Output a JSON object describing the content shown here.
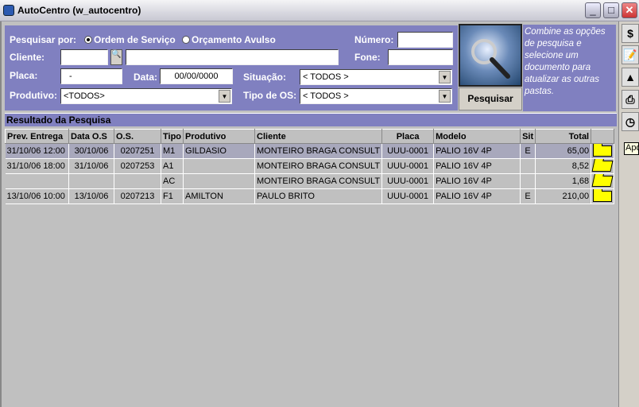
{
  "window": {
    "title": "AutoCentro (w_autocentro)",
    "minimize": "_",
    "maximize": "□",
    "close": "✕"
  },
  "search": {
    "search_by_label": "Pesquisar por:",
    "options": [
      {
        "label": "Ordem de Serviço",
        "selected": true
      },
      {
        "label": "Orçamento Avulso",
        "selected": false
      }
    ],
    "numero_label": "Número:",
    "numero_value": "",
    "cliente_label": "Cliente:",
    "cliente_code": "",
    "cliente_name": "",
    "fone_label": "Fone:",
    "fone_value": "",
    "placa_label": "Placa:",
    "placa_value": "-",
    "data_label": "Data:",
    "data_value": "00/00/0000",
    "situacao_label": "Situação:",
    "situacao_value": "< TODOS >",
    "produtivo_label": "Produtivo:",
    "produtivo_value": "<TODOS>",
    "tipo_os_label": "Tipo de OS:",
    "tipo_os_value": "< TODOS >",
    "button": "Pesquisar",
    "help": "Combine as opções de pesquisa e selecione um documento para atualizar as outras pastas."
  },
  "result": {
    "title": "Resultado da Pesquisa",
    "columns": [
      "Prev. Entrega",
      "Data O.S",
      "O.S.",
      "Tipo",
      "Produtivo",
      "Cliente",
      "Placa",
      "Modelo",
      "Sit",
      "Total",
      ""
    ],
    "rows": [
      {
        "prev": "31/10/06 12:00",
        "data": "30/10/06",
        "os": "0207251",
        "tipo": "M1",
        "produtivo": "GILDASIO",
        "cliente": "MONTEIRO BRAGA CONSULT",
        "placa": "UUU-0001",
        "modelo": "PALIO 16V 4P",
        "sit": "E",
        "total": "65,00",
        "folder": "closed"
      },
      {
        "prev": "31/10/06 18:00",
        "data": "31/10/06",
        "os": "0207253",
        "tipo": "A1",
        "produtivo": "",
        "cliente": "MONTEIRO BRAGA CONSULT",
        "placa": "UUU-0001",
        "modelo": "PALIO 16V 4P",
        "sit": "",
        "total": "8,52",
        "folder": "open"
      },
      {
        "prev": "",
        "data": "",
        "os": "",
        "tipo": "AC",
        "produtivo": "",
        "cliente": "MONTEIRO BRAGA CONSULT",
        "placa": "UUU-0001",
        "modelo": "PALIO 16V 4P",
        "sit": "",
        "total": "1,68",
        "folder": "open"
      },
      {
        "prev": "13/10/06 10:00",
        "data": "13/10/06",
        "os": "0207213",
        "tipo": "F1",
        "produtivo": "AMILTON",
        "cliente": "PAULO BRITO",
        "placa": "UUU-0001",
        "modelo": "PALIO 16V 4P",
        "sit": "E",
        "total": "210,00",
        "folder": "closed"
      }
    ]
  },
  "toolbar": {
    "buttons": [
      "dollar-icon",
      "edit-icon",
      "shapes-icon",
      "printer-icon",
      "clock-icon"
    ],
    "dollar": "$",
    "tooltip": "Apo"
  },
  "colors": {
    "panel": "#8080c0",
    "grid": "#c0c0c0",
    "selected_row": "#a8a8bc",
    "folder": "#ffff00"
  }
}
